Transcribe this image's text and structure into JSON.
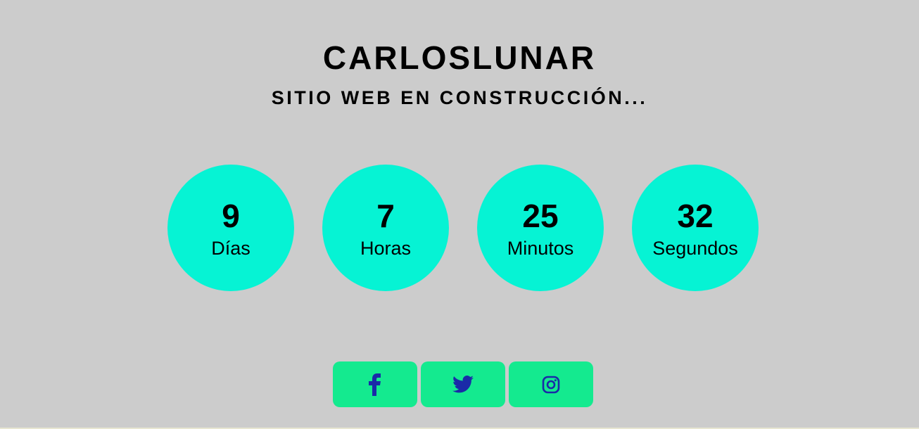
{
  "header": {
    "title": "CARLOSLUNAR",
    "subtitle": "SITIO WEB EN CONSTRUCCIÓN..."
  },
  "countdown": [
    {
      "value": "9",
      "label": "Días"
    },
    {
      "value": "7",
      "label": "Horas"
    },
    {
      "value": "25",
      "label": "Minutos"
    },
    {
      "value": "32",
      "label": "Segundos"
    }
  ],
  "social": [
    {
      "icon": "facebook-icon"
    },
    {
      "icon": "twitter-icon"
    },
    {
      "icon": "instagram-icon"
    }
  ],
  "colors": {
    "background": "#cccccc",
    "circle": "#06f3d4",
    "button": "#14ea8f",
    "icon": "#1a2aa8"
  }
}
